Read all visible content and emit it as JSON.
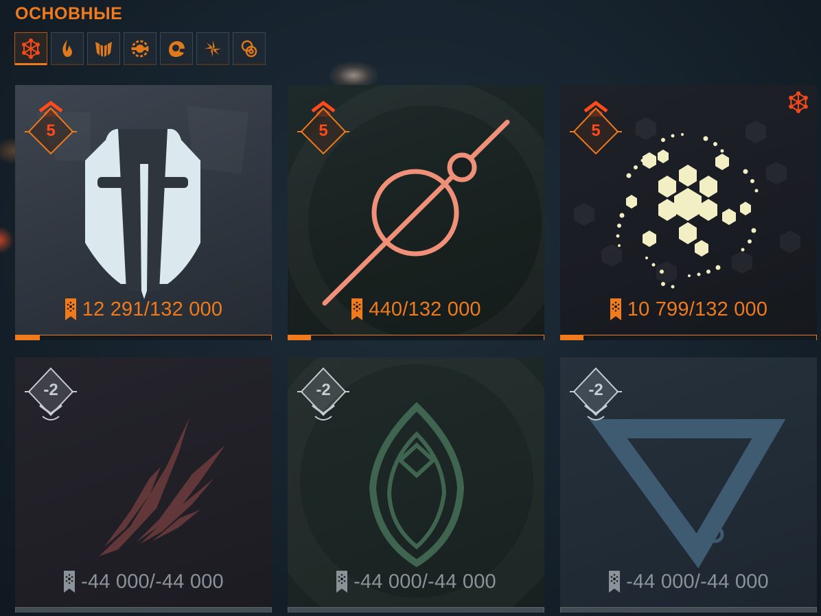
{
  "section_title": "ОСНОВНЫЕ",
  "tabs": [
    {
      "icon": "arc-network-icon",
      "active": true
    },
    {
      "icon": "flame-icon",
      "active": false
    },
    {
      "icon": "wings-icon",
      "active": false
    },
    {
      "icon": "gear-crest-icon",
      "active": false
    },
    {
      "icon": "helmet-icon",
      "active": false
    },
    {
      "icon": "spiral-icon",
      "active": false
    },
    {
      "icon": "rings-icon",
      "active": false
    }
  ],
  "accent_color": "#f07a1c",
  "cards": [
    {
      "name": "titan-card",
      "rank": "5",
      "progress_text": "12 291/132 000",
      "current": 12291,
      "max": 132000,
      "icon": "cloak-sword-icon",
      "locked": false
    },
    {
      "name": "hunter-card",
      "rank": "5",
      "progress_text": "440/132 000",
      "current": 440,
      "max": 132000,
      "icon": "strand-circle-icon",
      "locked": false
    },
    {
      "name": "warlock-card",
      "rank": "5",
      "progress_text": "10 799/132 000",
      "current": 10799,
      "max": 132000,
      "icon": "hex-spiral-icon",
      "locked": false,
      "corner_icon": "arc-network-icon"
    },
    {
      "name": "faction-card-1",
      "rank": "-2",
      "progress_text": "-44 000/-44 000",
      "current": -44000,
      "max": -44000,
      "icon": "feathers-icon",
      "locked": true
    },
    {
      "name": "faction-card-2",
      "rank": "-2",
      "progress_text": "-44 000/-44 000",
      "current": -44000,
      "max": -44000,
      "icon": "leaf-eye-icon",
      "locked": true
    },
    {
      "name": "faction-card-3",
      "rank": "-2",
      "progress_text": "-44 000/-44 000",
      "current": -44000,
      "max": -44000,
      "icon": "triangle-sigil-icon",
      "locked": true
    }
  ]
}
